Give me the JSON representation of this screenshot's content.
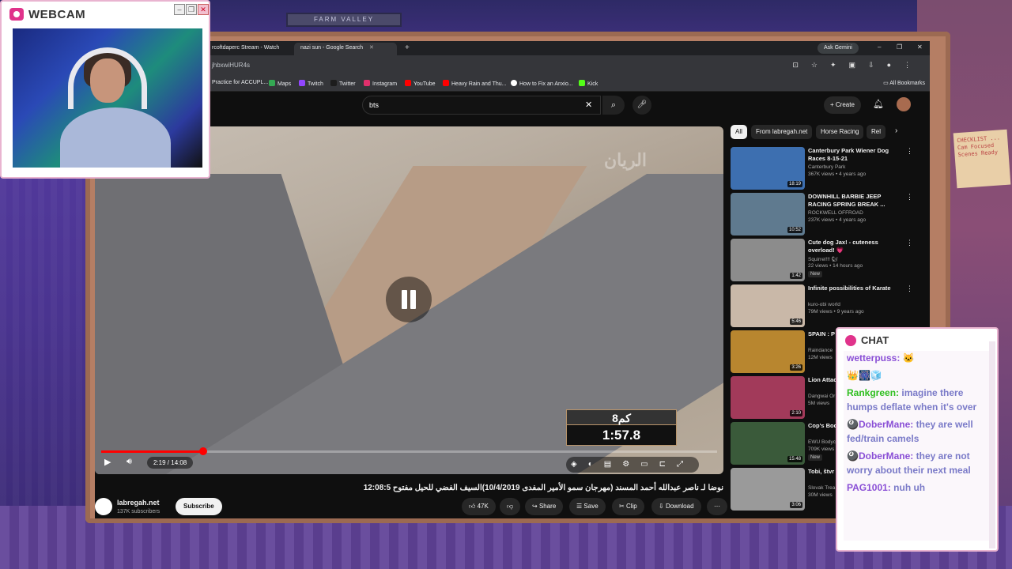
{
  "webcam": {
    "title": "WEBCAM"
  },
  "room": {
    "sign_text": "FARM VALLEY",
    "note_text": "CHECKLIST ... Cam Focused Scenes Ready"
  },
  "browser": {
    "tabs": [
      {
        "label": "rcoftdaperc Stream - Watch",
        "active": false
      },
      {
        "label": "nazi sun - Google Search",
        "active": true
      }
    ],
    "new_tab": "+",
    "gemini": "Ask Gemini",
    "window_controls": [
      "–",
      "❐",
      "✕"
    ],
    "url": "jhbxwiHUR4s",
    "bookmarks": [
      {
        "label": "Practice for ACCUPL...",
        "color": "#f4b400"
      },
      {
        "label": "Maps",
        "color": "#34a853"
      },
      {
        "label": "Twitch",
        "color": "#9146ff"
      },
      {
        "label": "Twitter",
        "color": "#1d1d1d"
      },
      {
        "label": "Instagram",
        "color": "#e1306c"
      },
      {
        "label": "YouTube",
        "color": "#ff0000"
      },
      {
        "label": "Heavy Rain and Thu...",
        "color": "#ff0000"
      },
      {
        "label": "How to Fix an Anxio...",
        "color": "#ffffff"
      },
      {
        "label": "Kick",
        "color": "#53fc18"
      }
    ],
    "all_bookmarks": "All Bookmarks"
  },
  "youtube": {
    "search_value": "bts",
    "create_label": "Create",
    "player": {
      "watermark": "الريان",
      "race_distance": "8كم",
      "race_time": "1:57.8",
      "time_display": "2:19 / 14:08",
      "progress_fraction": 0.165
    },
    "video_title": "نوضا لـ ناصر عبدالله أحمد المسند (مهرجان سمو الأمير المفدى 10/4/2019)السيف الفضي للحيل مفتوح 12:08:5",
    "channel": {
      "name": "labregah.net",
      "subscribers": "137K subscribers",
      "subscribe_label": "Subscribe"
    },
    "actions": {
      "likes": "47K",
      "share": "Share",
      "save": "Save",
      "clip": "Clip",
      "download": "Download"
    },
    "chips": [
      "All",
      "From labregah.net",
      "Horse Racing",
      "Rel"
    ],
    "recommendations": [
      {
        "title": "Canterbury Park Wiener Dog Races 8-15-21",
        "channel": "Canterbury Park",
        "meta": "367K views • 4 years ago",
        "duration": "18:19",
        "new": false,
        "thumb": "#3d6fb0"
      },
      {
        "title": "DOWNHILL BARBIE JEEP RACING SPRING BREAK ...",
        "channel": "ROCKWELL OFFROAD",
        "meta": "237K views • 4 years ago",
        "duration": "10:52",
        "new": false,
        "thumb": "#5f7a8f"
      },
      {
        "title": "Cute dog Jax! - cuteness overload! 💗",
        "channel": "Squirrel!!! 🐿",
        "meta": "22 views • 14 hours ago",
        "duration": "1:42",
        "new": true,
        "new_label": "New",
        "thumb": "#8c8c8c"
      },
      {
        "title": "Infinite possibilities of Karate",
        "channel": "kuro-obi world",
        "meta": "79M views • 9 years ago",
        "duration": "5:46",
        "new": false,
        "thumb": "#c9b8a8"
      },
      {
        "title": "SPAIN : P Fermin - F",
        "channel": "Raindance",
        "meta": "12M views",
        "duration": "3:26",
        "new": false,
        "thumb": "#b8862f"
      },
      {
        "title": "Lion Attac (Lion's Re",
        "channel": "Dangwai Or",
        "meta": "5M views",
        "duration": "2:10",
        "new": false,
        "thumb": "#a23a5a"
      },
      {
        "title": "Cop's Bod Behind Ar",
        "channel": "EWU Bodyc",
        "meta": "709K views",
        "duration": "15:48",
        "new": true,
        "new_label": "New",
        "thumb": "#3a5a3a"
      },
      {
        "title": "Tobi, štvr tahu (Kla",
        "channel": "Slovak Trea",
        "meta": "30M views",
        "duration": "3:06",
        "new": false,
        "thumb": "#9a9a9a"
      }
    ]
  },
  "chat": {
    "title": "CHAT",
    "messages": [
      {
        "user": "wetterpuss:",
        "text": "🐱",
        "user_color": "purple"
      },
      {
        "user": "",
        "text": "👑🎆🧊",
        "user_color": "purple"
      },
      {
        "user": "Rankgreen:",
        "text": "imagine there humps deflate when it's over",
        "user_color": "green"
      },
      {
        "user": "🎱DoberMane:",
        "text": "they are well fed/train camels",
        "user_color": "purple"
      },
      {
        "user": "🎱DoberMane:",
        "text": "they are not worry about their next meal",
        "user_color": "purple"
      },
      {
        "user": "PAG1001:",
        "text": "nuh uh",
        "user_color": "purple"
      }
    ]
  }
}
